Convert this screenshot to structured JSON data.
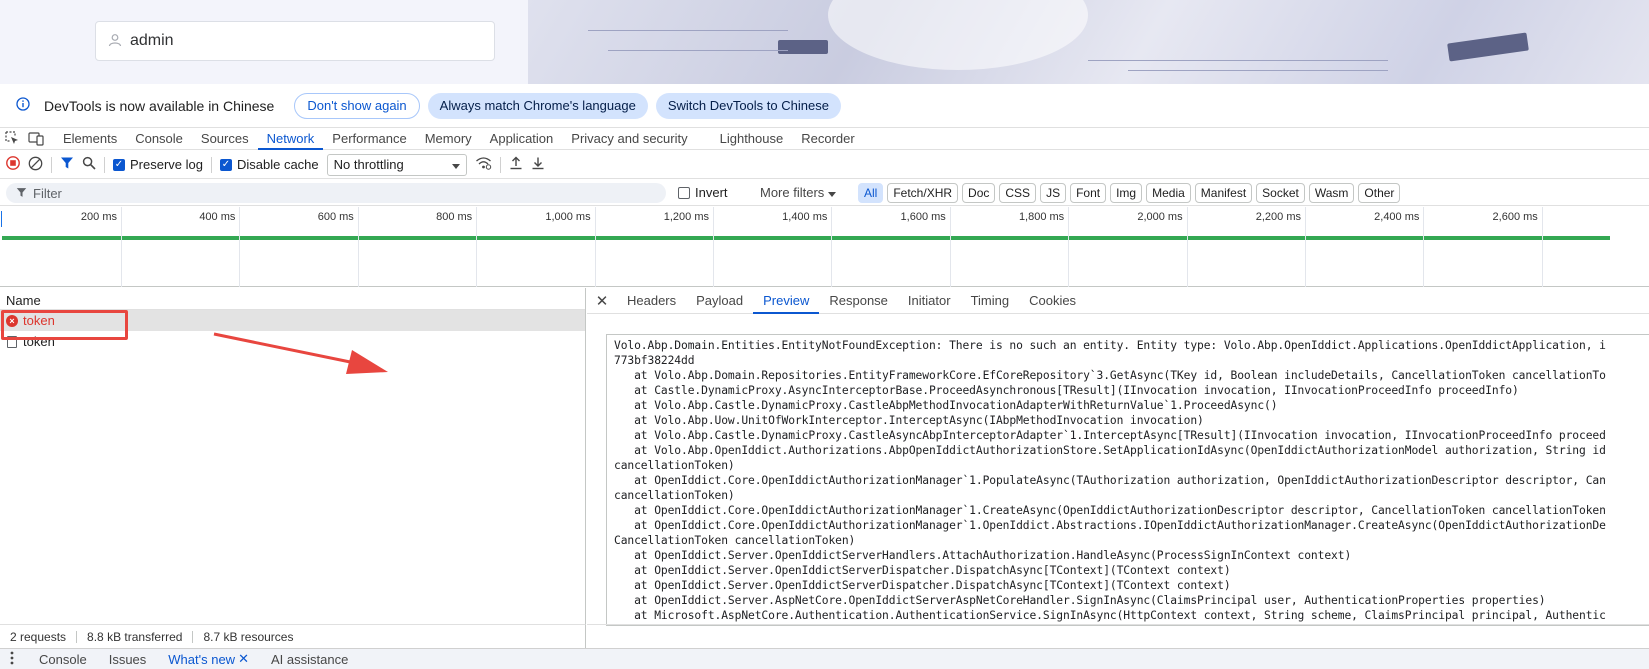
{
  "login": {
    "username_value": "admin"
  },
  "infobar": {
    "message": "DevTools is now available in Chinese",
    "btn_dont_show": "Don't show again",
    "btn_always_match": "Always match Chrome's language",
    "btn_switch": "Switch DevTools to Chinese"
  },
  "tabs": [
    {
      "label": "Elements"
    },
    {
      "label": "Console"
    },
    {
      "label": "Sources"
    },
    {
      "label": "Network"
    },
    {
      "label": "Performance"
    },
    {
      "label": "Memory"
    },
    {
      "label": "Application"
    },
    {
      "label": "Privacy and security"
    },
    {
      "label": "Lighthouse"
    },
    {
      "label": "Recorder"
    }
  ],
  "active_tab": "Network",
  "toolbar": {
    "preserve_log": "Preserve log",
    "disable_cache": "Disable cache",
    "throttling": "No throttling"
  },
  "filterbar": {
    "placeholder": "Filter",
    "invert": "Invert",
    "more_filters": "More filters",
    "types": [
      "All",
      "Fetch/XHR",
      "Doc",
      "CSS",
      "JS",
      "Font",
      "Img",
      "Media",
      "Manifest",
      "Socket",
      "Wasm",
      "Other"
    ]
  },
  "timeline": {
    "ticks": [
      "200 ms",
      "400 ms",
      "600 ms",
      "800 ms",
      "1,000 ms",
      "1,200 ms",
      "1,400 ms",
      "1,600 ms",
      "1,800 ms",
      "2,000 ms",
      "2,200 ms",
      "2,400 ms",
      "2,600 ms"
    ]
  },
  "request_list": {
    "column_name": "Name",
    "rows": [
      {
        "name": "token",
        "status": "error"
      },
      {
        "name": "token",
        "status": "ok"
      }
    ]
  },
  "detail": {
    "tabs": [
      "Headers",
      "Payload",
      "Preview",
      "Response",
      "Initiator",
      "Timing",
      "Cookies"
    ],
    "active_tab": "Preview",
    "preview_lines": [
      "Volo.Abp.Domain.Entities.EntityNotFoundException: There is no such an entity. Entity type: Volo.Abp.OpenIddict.Applications.OpenIddictApplication, i",
      "773bf38224dd",
      "   at Volo.Abp.Domain.Repositories.EntityFrameworkCore.EfCoreRepository`3.GetAsync(TKey id, Boolean includeDetails, CancellationToken cancellationTo",
      "   at Castle.DynamicProxy.AsyncInterceptorBase.ProceedAsynchronous[TResult](IInvocation invocation, IInvocationProceedInfo proceedInfo)",
      "   at Volo.Abp.Castle.DynamicProxy.CastleAbpMethodInvocationAdapterWithReturnValue`1.ProceedAsync()",
      "   at Volo.Abp.Uow.UnitOfWorkInterceptor.InterceptAsync(IAbpMethodInvocation invocation)",
      "   at Volo.Abp.Castle.DynamicProxy.CastleAsyncAbpInterceptorAdapter`1.InterceptAsync[TResult](IInvocation invocation, IInvocationProceedInfo proceed",
      "   at Volo.Abp.OpenIddict.Authorizations.AbpOpenIddictAuthorizationStore.SetApplicationIdAsync(OpenIddictAuthorizationModel authorization, String id",
      "cancellationToken)",
      "   at OpenIddict.Core.OpenIddictAuthorizationManager`1.PopulateAsync(TAuthorization authorization, OpenIddictAuthorizationDescriptor descriptor, Can",
      "cancellationToken)",
      "   at OpenIddict.Core.OpenIddictAuthorizationManager`1.CreateAsync(OpenIddictAuthorizationDescriptor descriptor, CancellationToken cancellationToken",
      "   at OpenIddict.Core.OpenIddictAuthorizationManager`1.OpenIddict.Abstractions.IOpenIddictAuthorizationManager.CreateAsync(OpenIddictAuthorizationDe",
      "CancellationToken cancellationToken)",
      "   at OpenIddict.Server.OpenIddictServerHandlers.AttachAuthorization.HandleAsync(ProcessSignInContext context)",
      "   at OpenIddict.Server.OpenIddictServerDispatcher.DispatchAsync[TContext](TContext context)",
      "   at OpenIddict.Server.OpenIddictServerDispatcher.DispatchAsync[TContext](TContext context)",
      "   at OpenIddict.Server.AspNetCore.OpenIddictServerAspNetCoreHandler.SignInAsync(ClaimsPrincipal user, AuthenticationProperties properties)",
      "   at Microsoft.AspNetCore.Authentication.AuthenticationService.SignInAsync(HttpContext context, String scheme, ClaimsPrincipal principal, Authentic"
    ]
  },
  "statusbar": {
    "requests": "2 requests",
    "transferred": "8.8 kB transferred",
    "resources": "8.7 kB resources"
  },
  "drawer": {
    "tabs": [
      "Console",
      "Issues",
      "What's new",
      "AI assistance"
    ],
    "active": "What's new"
  },
  "colors": {
    "accent": "#0b57d0",
    "error": "#dc362e",
    "waterfall": "#34a853",
    "annotation": "#e8463f"
  }
}
